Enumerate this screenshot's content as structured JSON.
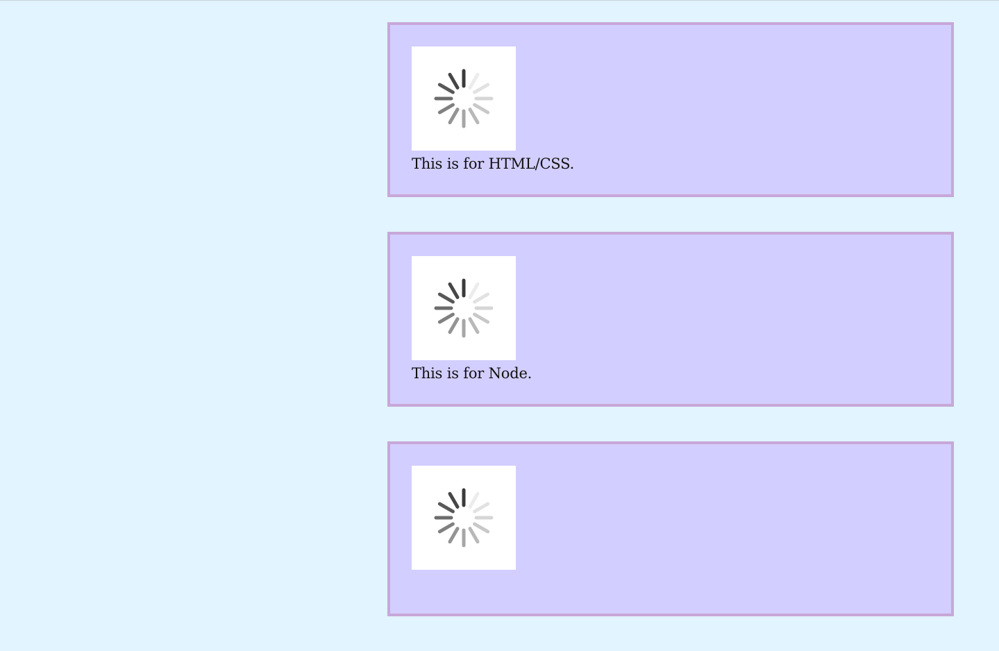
{
  "cards": [
    {
      "caption": "This is for HTML/CSS.",
      "icon": "loading-spinner-icon"
    },
    {
      "caption": "This is for Node.",
      "icon": "loading-spinner-icon"
    },
    {
      "caption": "",
      "icon": "loading-spinner-icon"
    }
  ],
  "colors": {
    "page_background": "#e1f4ff",
    "card_background": "#d2ceff",
    "card_border": "#c8a7d8",
    "thumb_background": "#ffffff"
  }
}
